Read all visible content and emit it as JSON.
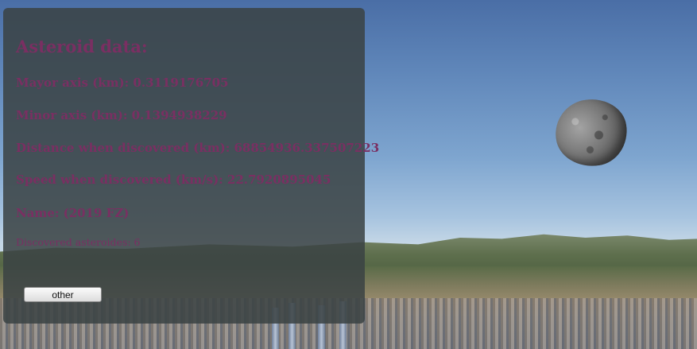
{
  "panel": {
    "title": "Asteroid data:",
    "fields": [
      {
        "label": "Mayor axis (km): 0.3119176705"
      },
      {
        "label": "Minor axis (km): 0.1394938229"
      },
      {
        "label": "Distance when discovered (km): 68854936.337507223"
      },
      {
        "label": "Speed when discovered (km/s): 22.7920895045"
      },
      {
        "label": "Name: (2019 FZ)"
      }
    ],
    "discovered": "Discovered asteroides: 6",
    "button_label": "other"
  },
  "colors": {
    "text": "#7a2f62",
    "panel": "#3a4244"
  }
}
